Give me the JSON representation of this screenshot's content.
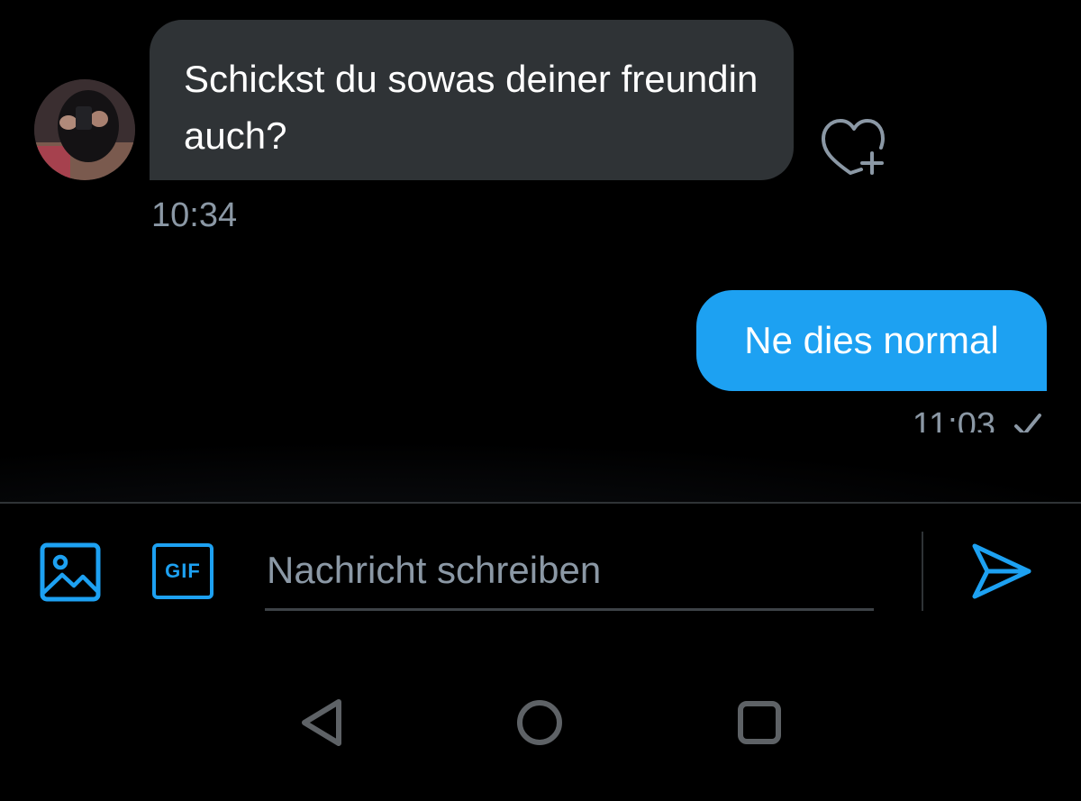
{
  "colors": {
    "background": "#000000",
    "incoming_bubble": "#2f3336",
    "outgoing_bubble": "#1da1f2",
    "accent": "#1da1f2",
    "muted_text": "#8b98a5",
    "nav_icon": "#5e6266"
  },
  "messages": [
    {
      "direction": "incoming",
      "text": "Schickst du sowas deiner freundin auch?",
      "time": "10:34",
      "reaction_icon": "heart-plus-icon"
    },
    {
      "direction": "outgoing",
      "text": "Ne dies normal",
      "time": "11:03",
      "status_icon": "check-icon"
    }
  ],
  "composer": {
    "media_icon": "image-icon",
    "gif_label": "GIF",
    "input_placeholder": "Nachricht schreiben",
    "input_value": "",
    "send_icon": "send-icon"
  },
  "nav_bar": {
    "icons": [
      "back-triangle-icon",
      "home-circle-icon",
      "recents-square-icon"
    ]
  }
}
